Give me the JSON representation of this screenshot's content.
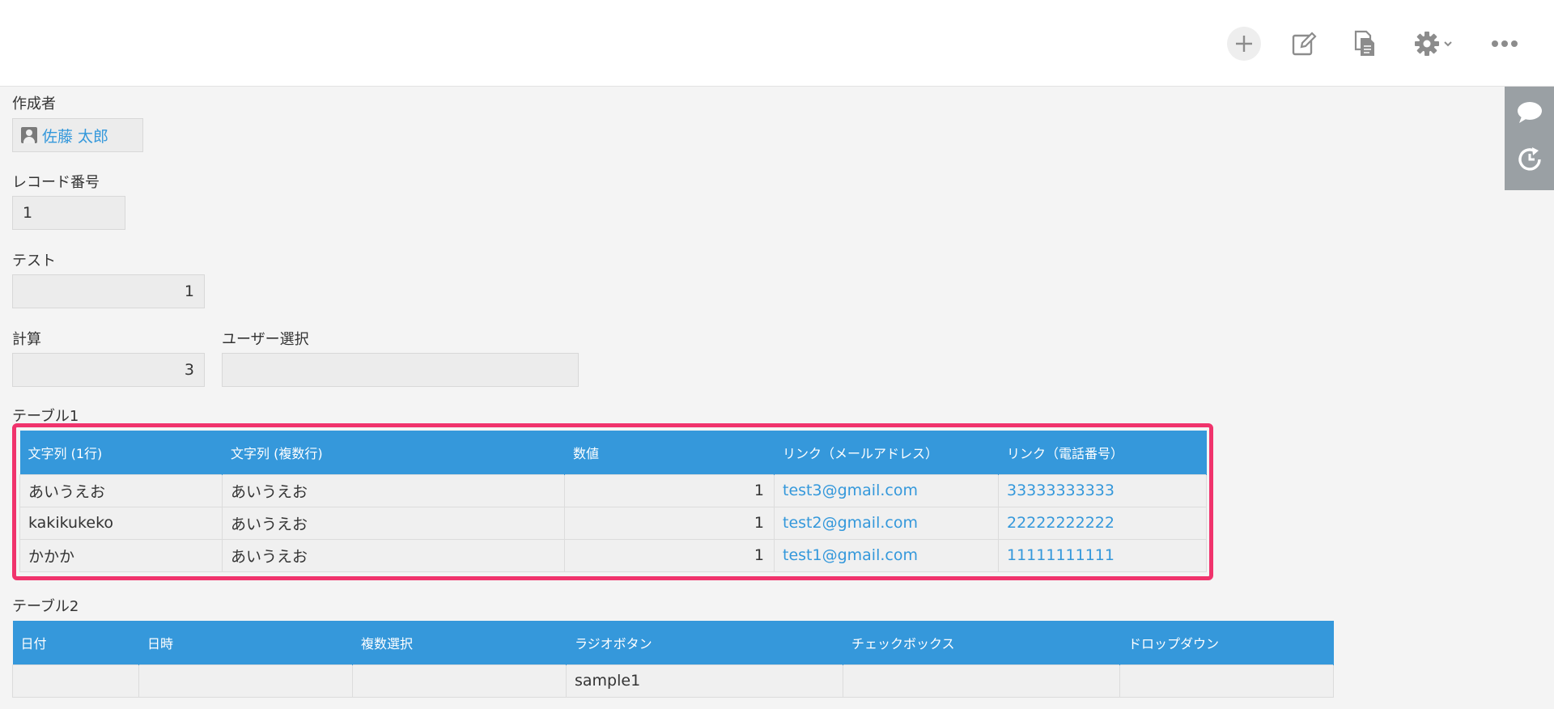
{
  "toolbar": {
    "add_icon": "plus-icon",
    "edit_icon": "edit-icon",
    "copy_icon": "copy-record-icon",
    "settings_icon": "gear-icon",
    "more_icon": "more-icon"
  },
  "side_panel": {
    "comment_icon": "comment-icon",
    "history_icon": "history-icon"
  },
  "fields": {
    "creator": {
      "label": "作成者",
      "value": "佐藤 太郎"
    },
    "record_number": {
      "label": "レコード番号",
      "value": "1"
    },
    "test": {
      "label": "テスト",
      "value": "1"
    },
    "calc": {
      "label": "計算",
      "value": "3"
    },
    "user_select": {
      "label": "ユーザー選択",
      "value": ""
    }
  },
  "table1": {
    "label": "テーブル1",
    "headers": [
      "文字列 (1行)",
      "文字列 (複数行)",
      "数値",
      "リンク（メールアドレス）",
      "リンク（電話番号）"
    ],
    "rows": [
      [
        "あいうえお",
        "あいうえお",
        "1",
        "test3@gmail.com",
        "33333333333"
      ],
      [
        "kakikukeko",
        "あいうえお",
        "1",
        "test2@gmail.com",
        "22222222222"
      ],
      [
        "かかか",
        "あいうえお",
        "1",
        "test1@gmail.com",
        "11111111111"
      ]
    ]
  },
  "table2": {
    "label": "テーブル2",
    "headers": [
      "日付",
      "日時",
      "複数選択",
      "ラジオボタン",
      "チェックボックス",
      "ドロップダウン"
    ],
    "rows": [
      [
        "",
        "",
        "",
        "sample1",
        "",
        ""
      ]
    ]
  },
  "colors": {
    "header_blue": "#3598db",
    "link_blue": "#3498db",
    "highlight_pink": "#f0336c"
  }
}
